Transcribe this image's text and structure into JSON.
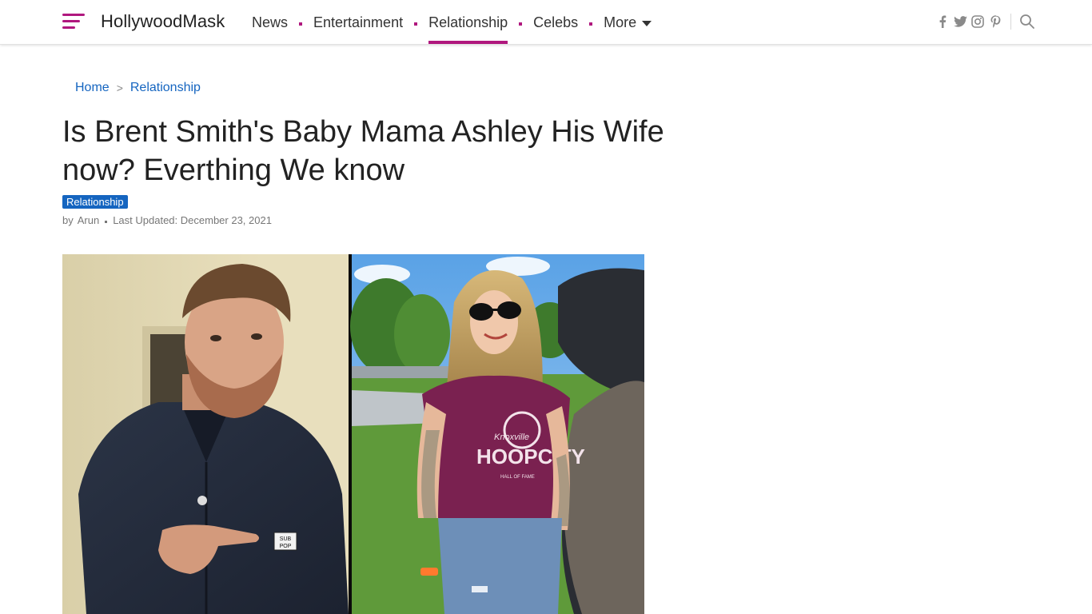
{
  "site": {
    "name": "HollywoodMask"
  },
  "nav": {
    "items": [
      {
        "label": "News",
        "active": false
      },
      {
        "label": "Entertainment",
        "active": false
      },
      {
        "label": "Relationship",
        "active": true
      },
      {
        "label": "Celebs",
        "active": false
      },
      {
        "label": "More",
        "active": false,
        "dropdown": true
      }
    ]
  },
  "social_icons": [
    "facebook-icon",
    "twitter-icon",
    "instagram-icon",
    "pinterest-icon"
  ],
  "breadcrumb": {
    "home": "Home",
    "separator": ">",
    "current": "Relationship"
  },
  "article": {
    "title": "Is Brent Smith's Baby Mama Ashley His Wife now? Everthing We know",
    "category": "Relationship",
    "by_label": "by",
    "author": "Arun",
    "updated": "Last Updated: December 23, 2021"
  },
  "hero": {
    "patch_text_1": "SUB",
    "patch_text_2": "POP",
    "shirt_text_1": "Knoxville",
    "shirt_text_2": "HOOPCITY",
    "shirt_text_3": "HALL OF FAME"
  },
  "colors": {
    "accent": "#b0187e",
    "link": "#1565c0",
    "badge": "#1565c0"
  }
}
